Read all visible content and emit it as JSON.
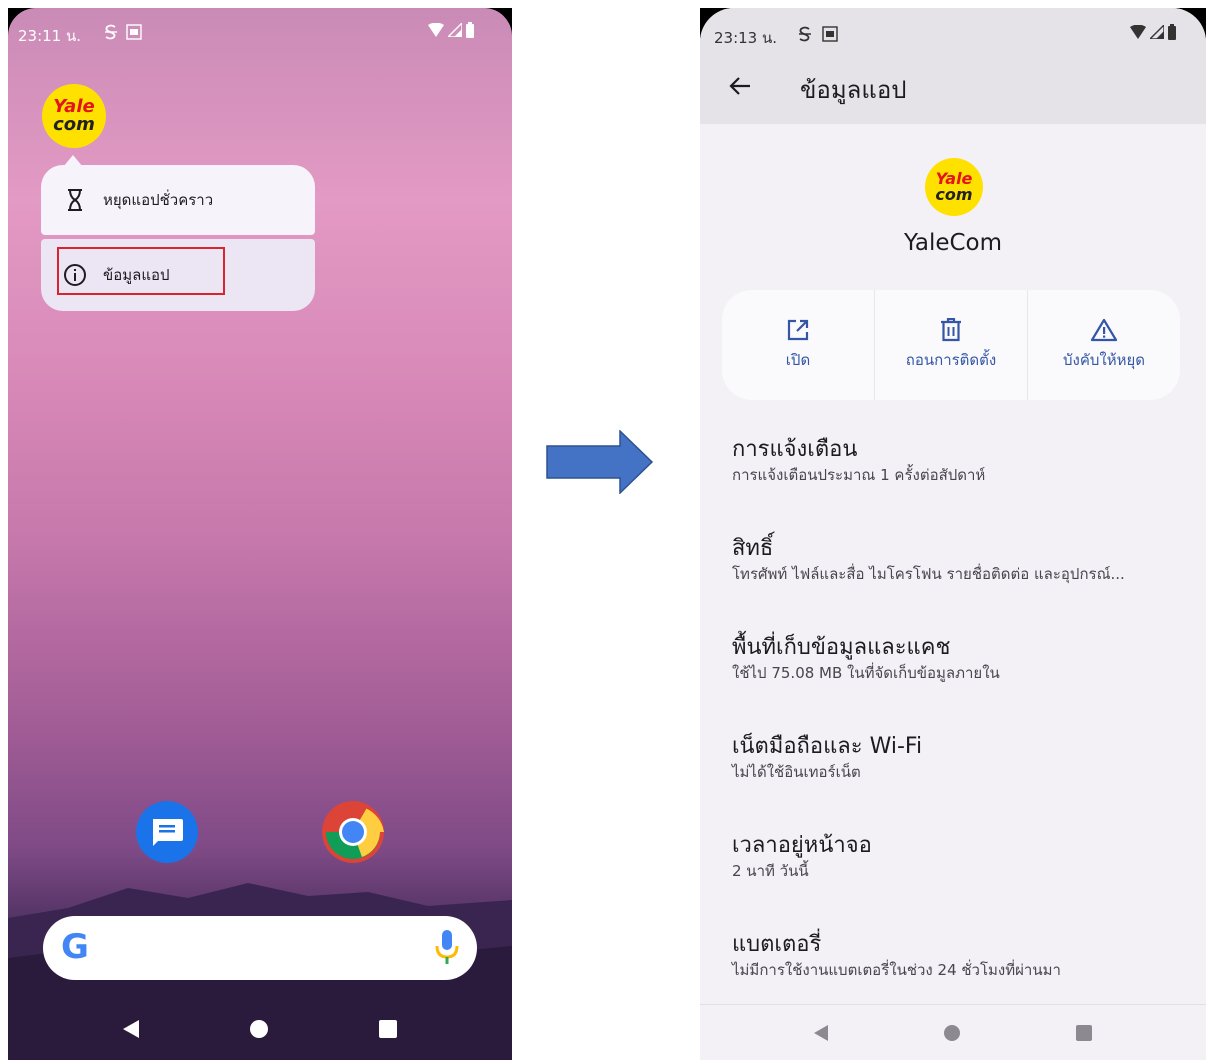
{
  "left_phone": {
    "status_bar": {
      "time": "23:11 น.",
      "icons": [
        "s-icon",
        "notification-thumb",
        "wifi-icon",
        "signal-icon",
        "battery-icon"
      ]
    },
    "app_logo": {
      "line1": "Yale",
      "line2": "com"
    },
    "popup_menu": {
      "items": [
        {
          "label": "หยุดแอปชั่วคราว",
          "icon": "hourglass-icon"
        },
        {
          "label": "ข้อมูลแอป",
          "icon": "info-icon"
        }
      ]
    },
    "search_bar": {
      "logo": "G"
    }
  },
  "right_phone": {
    "status_bar": {
      "time": "23:13 น."
    },
    "app_bar": {
      "title": "ข้อมูลแอป"
    },
    "app_logo": {
      "line1": "Yale",
      "line2": "com"
    },
    "app_name": "YaleCom",
    "actions": [
      {
        "label": "เปิด",
        "icon": "open-external-icon"
      },
      {
        "label": "ถอนการติดตั้ง",
        "icon": "trash-icon"
      },
      {
        "label": "บังคับให้หยุด",
        "icon": "warning-icon"
      }
    ],
    "settings": [
      {
        "title": "การแจ้งเตือน",
        "subtitle": "การแจ้งเตือนประมาณ 1 ครั้งต่อสัปดาห์"
      },
      {
        "title": "สิทธิ์",
        "subtitle": "โทรศัพท์ ไฟล์และสื่อ ไมโครโฟน รายชื่อติดต่อ และอุปกรณ์..."
      },
      {
        "title": "พื้นที่เก็บข้อมูลและแคช",
        "subtitle": "ใช้ไป 75.08 MB ในที่จัดเก็บข้อมูลภายใน"
      },
      {
        "title": "เน็ตมือถือและ Wi-Fi",
        "subtitle": "ไม่ได้ใช้อินเทอร์เน็ต"
      },
      {
        "title": "เวลาอยู่หน้าจอ",
        "subtitle": "2 นาที วันนี้"
      },
      {
        "title": "แบตเตอรี่",
        "subtitle": "ไม่มีการใช้งานแบตเตอรี่ในช่วง 24 ชั่วโมงที่ผ่านมา"
      }
    ]
  },
  "colors": {
    "accent": "#3456a6",
    "highlight": "#d9232d",
    "logo_yellow": "#ffe100",
    "arrow": "#4472c4"
  }
}
